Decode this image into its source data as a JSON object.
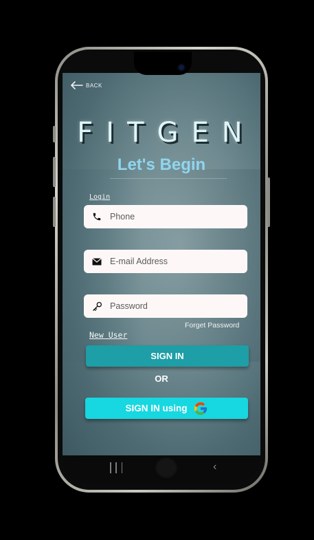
{
  "header": {
    "back_label": "BACK"
  },
  "brand": {
    "logo_text": "FITGEN",
    "subtitle": "Let's Begin"
  },
  "form": {
    "login_label": "Login",
    "phone_placeholder": "Phone",
    "email_placeholder": "E-mail Address",
    "password_placeholder": "Password",
    "forget_password": "Forget Password",
    "new_user": "New User"
  },
  "actions": {
    "sign_in": "SIGN IN",
    "or": "OR",
    "sign_in_google": "SIGN IN using"
  },
  "icons": {
    "back": "arrow-left-icon",
    "phone": "phone-icon",
    "email": "envelope-icon",
    "password": "key-icon",
    "google": "google-logo-icon"
  },
  "colors": {
    "sign_in_button": "#1e9ea6",
    "google_button": "#17d7e0",
    "subtitle": "#8fd5ee"
  }
}
